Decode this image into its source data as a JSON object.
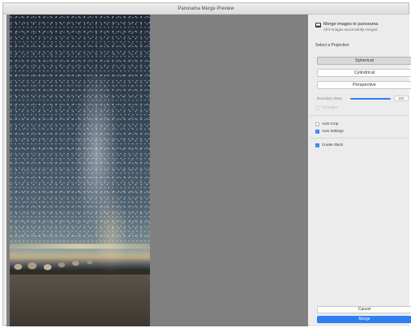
{
  "window": {
    "title": "Panorama Merge Preview"
  },
  "panel": {
    "info_title": "Merge images to panorama",
    "info_subtitle": "All 8 images successfully merged",
    "projection_label": "Select a Projection",
    "projections": [
      {
        "label": "Spherical",
        "selected": true
      },
      {
        "label": "Cylindrical",
        "selected": false
      },
      {
        "label": "Perspective",
        "selected": false
      }
    ],
    "boundary_warp": {
      "label": "Boundary Warp",
      "value": "100",
      "level": 1.0
    },
    "fill_edges": {
      "label": "Fill Edges",
      "checked": false,
      "enabled": false
    },
    "auto_crop": {
      "label": "Auto Crop",
      "checked": false
    },
    "auto_settings": {
      "label": "Auto Settings",
      "checked": true
    },
    "create_stack": {
      "label": "Create Stack",
      "checked": true
    },
    "cancel_label": "Cancel",
    "merge_label": "Merge"
  },
  "colors": {
    "accent": "#2f7ff0",
    "preview_bg": "#808080",
    "panel_bg": "#ececec"
  },
  "icons": {
    "pano": "panorama-icon",
    "check": "checkmark-icon"
  }
}
